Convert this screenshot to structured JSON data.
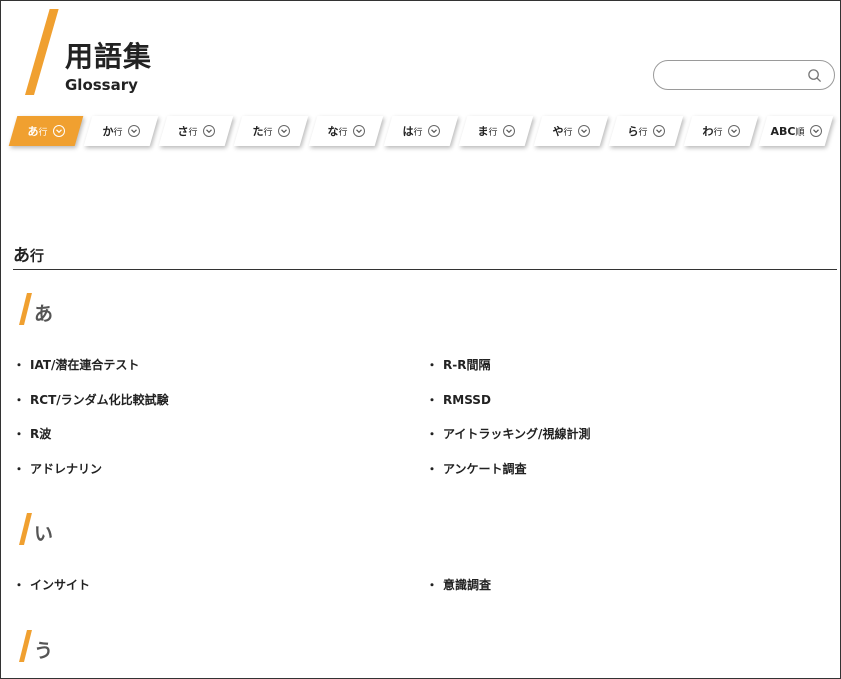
{
  "header": {
    "title_ja": "用語集",
    "title_en": "Glossary",
    "accent_color": "#F0A030"
  },
  "search": {
    "value": "",
    "placeholder": "",
    "icon": "search-icon"
  },
  "tabs": [
    {
      "kana": "あ",
      "suffix": "行",
      "active": true
    },
    {
      "kana": "か",
      "suffix": "行"
    },
    {
      "kana": "さ",
      "suffix": "行"
    },
    {
      "kana": "た",
      "suffix": "行"
    },
    {
      "kana": "な",
      "suffix": "行"
    },
    {
      "kana": "は",
      "suffix": "行"
    },
    {
      "kana": "ま",
      "suffix": "行"
    },
    {
      "kana": "や",
      "suffix": "行"
    },
    {
      "kana": "ら",
      "suffix": "行"
    },
    {
      "kana": "わ",
      "suffix": "行"
    },
    {
      "kana": "ABC",
      "suffix": "順"
    }
  ],
  "section": {
    "kana": "あ",
    "suffix": "行"
  },
  "groups": [
    {
      "kana": "あ",
      "terms": [
        "IAT/潜在連合テスト",
        "R-R間隔",
        "RCT/ランダム化比較試験",
        "RMSSD",
        "R波",
        "アイトラッキング/視線計測",
        "アドレナリン",
        "アンケート調査"
      ]
    },
    {
      "kana": "い",
      "terms": [
        "インサイト",
        "意識調査"
      ]
    },
    {
      "kana": "う",
      "terms": []
    }
  ],
  "bullet": "・"
}
